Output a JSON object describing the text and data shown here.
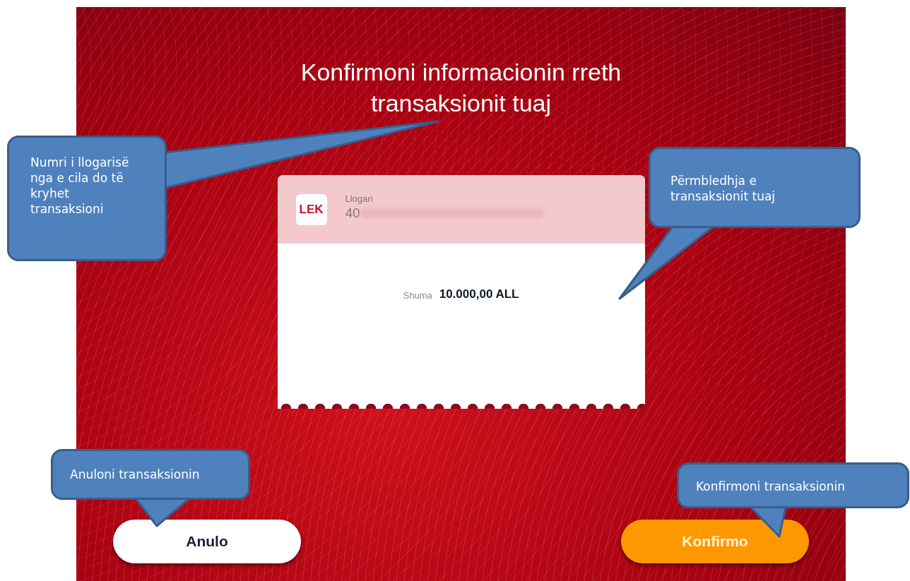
{
  "screen": {
    "title": "Konfirmoni informacionin rreth transaksionit tuaj",
    "account": {
      "currency_badge": "LEK",
      "label": "Llogari",
      "number": "40"
    },
    "amount": {
      "label": "Shuma",
      "value": "10.000,00 ALL"
    },
    "buttons": [
      {
        "label": "Anulo",
        "kind": "secondary"
      },
      {
        "label": "Konfirmo",
        "kind": "primary"
      }
    ]
  },
  "callouts": [
    {
      "text": "Numri i llogarisë nga e cila do të kryhet transaksioni"
    },
    {
      "text": "Përmbledhja e transaksionit tuaj"
    },
    {
      "text": "Anuloni transaksionin"
    },
    {
      "text": "Konfirmoni transaksionin"
    }
  ]
}
